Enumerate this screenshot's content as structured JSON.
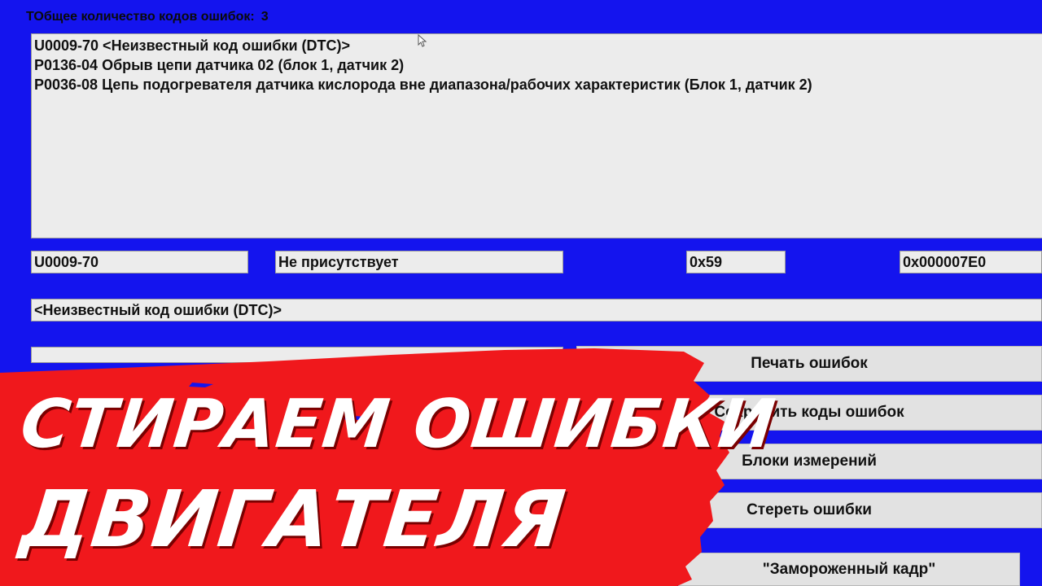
{
  "header": {
    "label": "ТОбщее количество кодов ошибок:",
    "count": "3"
  },
  "dtc_list": [
    "U0009-70 <Неизвестный код ошибки (DTC)>",
    "P0136-04 Обрыв цепи датчика 02 (блок 1, датчик 2)",
    "P0036-08 Цепь подогревателя датчика кислорода вне диапазона/рабочих характеристик (Блок 1, датчик 2)"
  ],
  "details": {
    "code": "U0009-70",
    "status": "Не присутствует",
    "hex1": "0x59",
    "hex2": "0x000007E0",
    "description": "<Неизвестный код ошибки (DTC)>"
  },
  "buttons": {
    "print": "Печать ошибок",
    "save": "Сохранить коды ошибок",
    "measure": "Блоки измерений",
    "erase": "Стереть ошибки",
    "freeze": "\"Замороженный кадр\""
  },
  "banner": {
    "line1": "СТИРАЕМ ОШИБКИ",
    "line2": "ДВИГАТЕЛЯ",
    "color": "#f0181c"
  },
  "theme": {
    "background": "#1414ee",
    "panel": "#ececec"
  }
}
